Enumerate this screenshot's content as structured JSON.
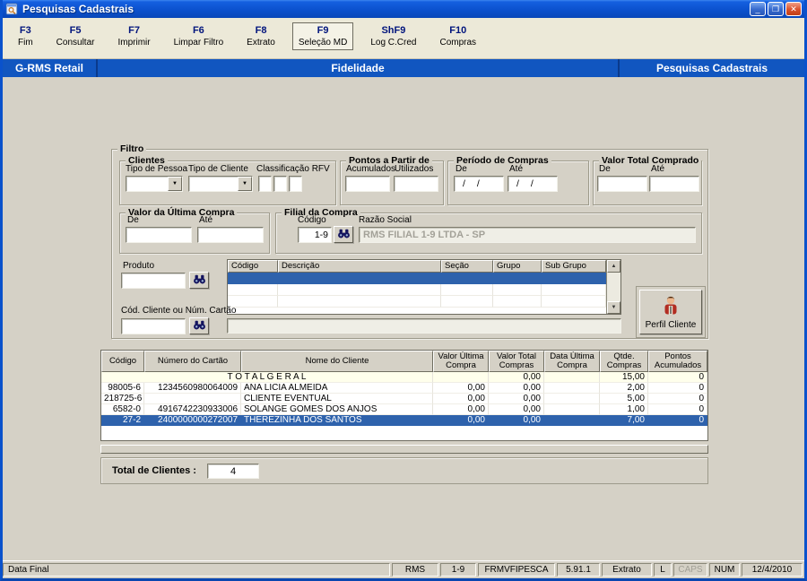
{
  "colors": {
    "titlebar_blue": "#0B51CE",
    "banner_blue": "#1156C0",
    "selection_blue": "#2E62AC",
    "toolbar_bg": "#ECE9D8",
    "content_bg": "#D5D1C6"
  },
  "icons": {
    "minimize": "_",
    "restore": "❐",
    "close": "✕",
    "dropdown_arrow": "▼",
    "scroll_up": "▲",
    "scroll_down": "▼"
  },
  "window": {
    "title": "Pesquisas Cadastrais"
  },
  "toolbar": [
    {
      "key": "F3",
      "label": "Fim"
    },
    {
      "key": "F5",
      "label": "Consultar"
    },
    {
      "key": "F7",
      "label": "Imprimir"
    },
    {
      "key": "F6",
      "label": "Limpar Filtro"
    },
    {
      "key": "F8",
      "label": "Extrato"
    },
    {
      "key": "F9",
      "label": "Seleção MD"
    },
    {
      "key": "ShF9",
      "label": "Log C.Cred"
    },
    {
      "key": "F10",
      "label": "Compras"
    }
  ],
  "banner": {
    "left": "G-RMS Retail",
    "center": "Fidelidade",
    "right": "Pesquisas Cadastrais"
  },
  "filter": {
    "legend": "Filtro",
    "clientes": {
      "legend": "Clientes",
      "tipo_pessoa_label": "Tipo de Pessoa",
      "tipo_cliente_label": "Tipo de Cliente",
      "classificacao_rfv_label": "Classificação RFV"
    },
    "pontos": {
      "legend": "Pontos a Partir de",
      "acumulados_label": "Acumulados",
      "utilizados_label": "Utilizados"
    },
    "periodo": {
      "legend": "Período de Compras",
      "de_label": "De",
      "ate_label": "Até",
      "de_value": "/ /",
      "ate_value": "/ /"
    },
    "valor_total_comprado": {
      "legend": "Valor Total Comprado",
      "de_label": "De",
      "ate_label": "Até"
    },
    "valor_ultima_compra": {
      "legend": "Valor da Última Compra",
      "de_label": "De",
      "ate_label": "Até"
    },
    "filial": {
      "legend": "Filial da Compra",
      "codigo_label": "Código",
      "codigo_value": "1-9",
      "razao_social_label": "Razão Social",
      "razao_social_value": "RMS FILIAL 1-9 LTDA - SP"
    },
    "produto_label": "Produto",
    "produto_grid_headers": [
      "Código",
      "Descrição",
      "Seção",
      "Grupo",
      "Sub Grupo"
    ],
    "cod_cliente_label": "Cód. Cliente ou Núm. Cartão",
    "perfil_cliente_label": "Perfil Cliente"
  },
  "results": {
    "headers": [
      "Código",
      "Número do Cartão",
      "Nome do Cliente",
      "Valor Última\nCompra",
      "Valor Total\nCompras",
      "Data Última\nCompra",
      "Qtde.\nCompras",
      "Pontos\nAcumulados"
    ],
    "total": {
      "label": "T O T A L  G E R A L",
      "valor_total_compras": "0,00",
      "qtde_compras": "15,00",
      "pontos_acumulados": "0"
    },
    "rows": [
      {
        "codigo": "98005-6",
        "cartao": "1234560980064009",
        "nome": "ANA LICIA ALMEIDA",
        "valor_ultima": "0,00",
        "valor_total": "0,00",
        "data_ultima": "",
        "qtde": "2,00",
        "pontos": "0"
      },
      {
        "codigo": "218725-6",
        "cartao": "",
        "nome": "CLIENTE EVENTUAL",
        "valor_ultima": "0,00",
        "valor_total": "0,00",
        "data_ultima": "",
        "qtde": "5,00",
        "pontos": "0"
      },
      {
        "codigo": "6582-0",
        "cartao": "4916742230933006",
        "nome": "SOLANGE GOMES DOS ANJOS",
        "valor_ultima": "0,00",
        "valor_total": "0,00",
        "data_ultima": "",
        "qtde": "1,00",
        "pontos": "0"
      },
      {
        "codigo": "27-2",
        "cartao": "2400000000272007",
        "nome": "THEREZINHA DOS SANTOS",
        "valor_ultima": "0,00",
        "valor_total": "0,00",
        "data_ultima": "",
        "qtde": "7,00",
        "pontos": "0"
      }
    ]
  },
  "total_clientes": {
    "label": "Total de Clientes :",
    "value": "4"
  },
  "statusbar": {
    "left": "Data Final",
    "panels": [
      "RMS",
      "1-9",
      "FRMVFIPESCA",
      "5.91.1",
      "Extrato",
      "L",
      "CAPS",
      "NUM",
      "12/4/2010"
    ]
  }
}
